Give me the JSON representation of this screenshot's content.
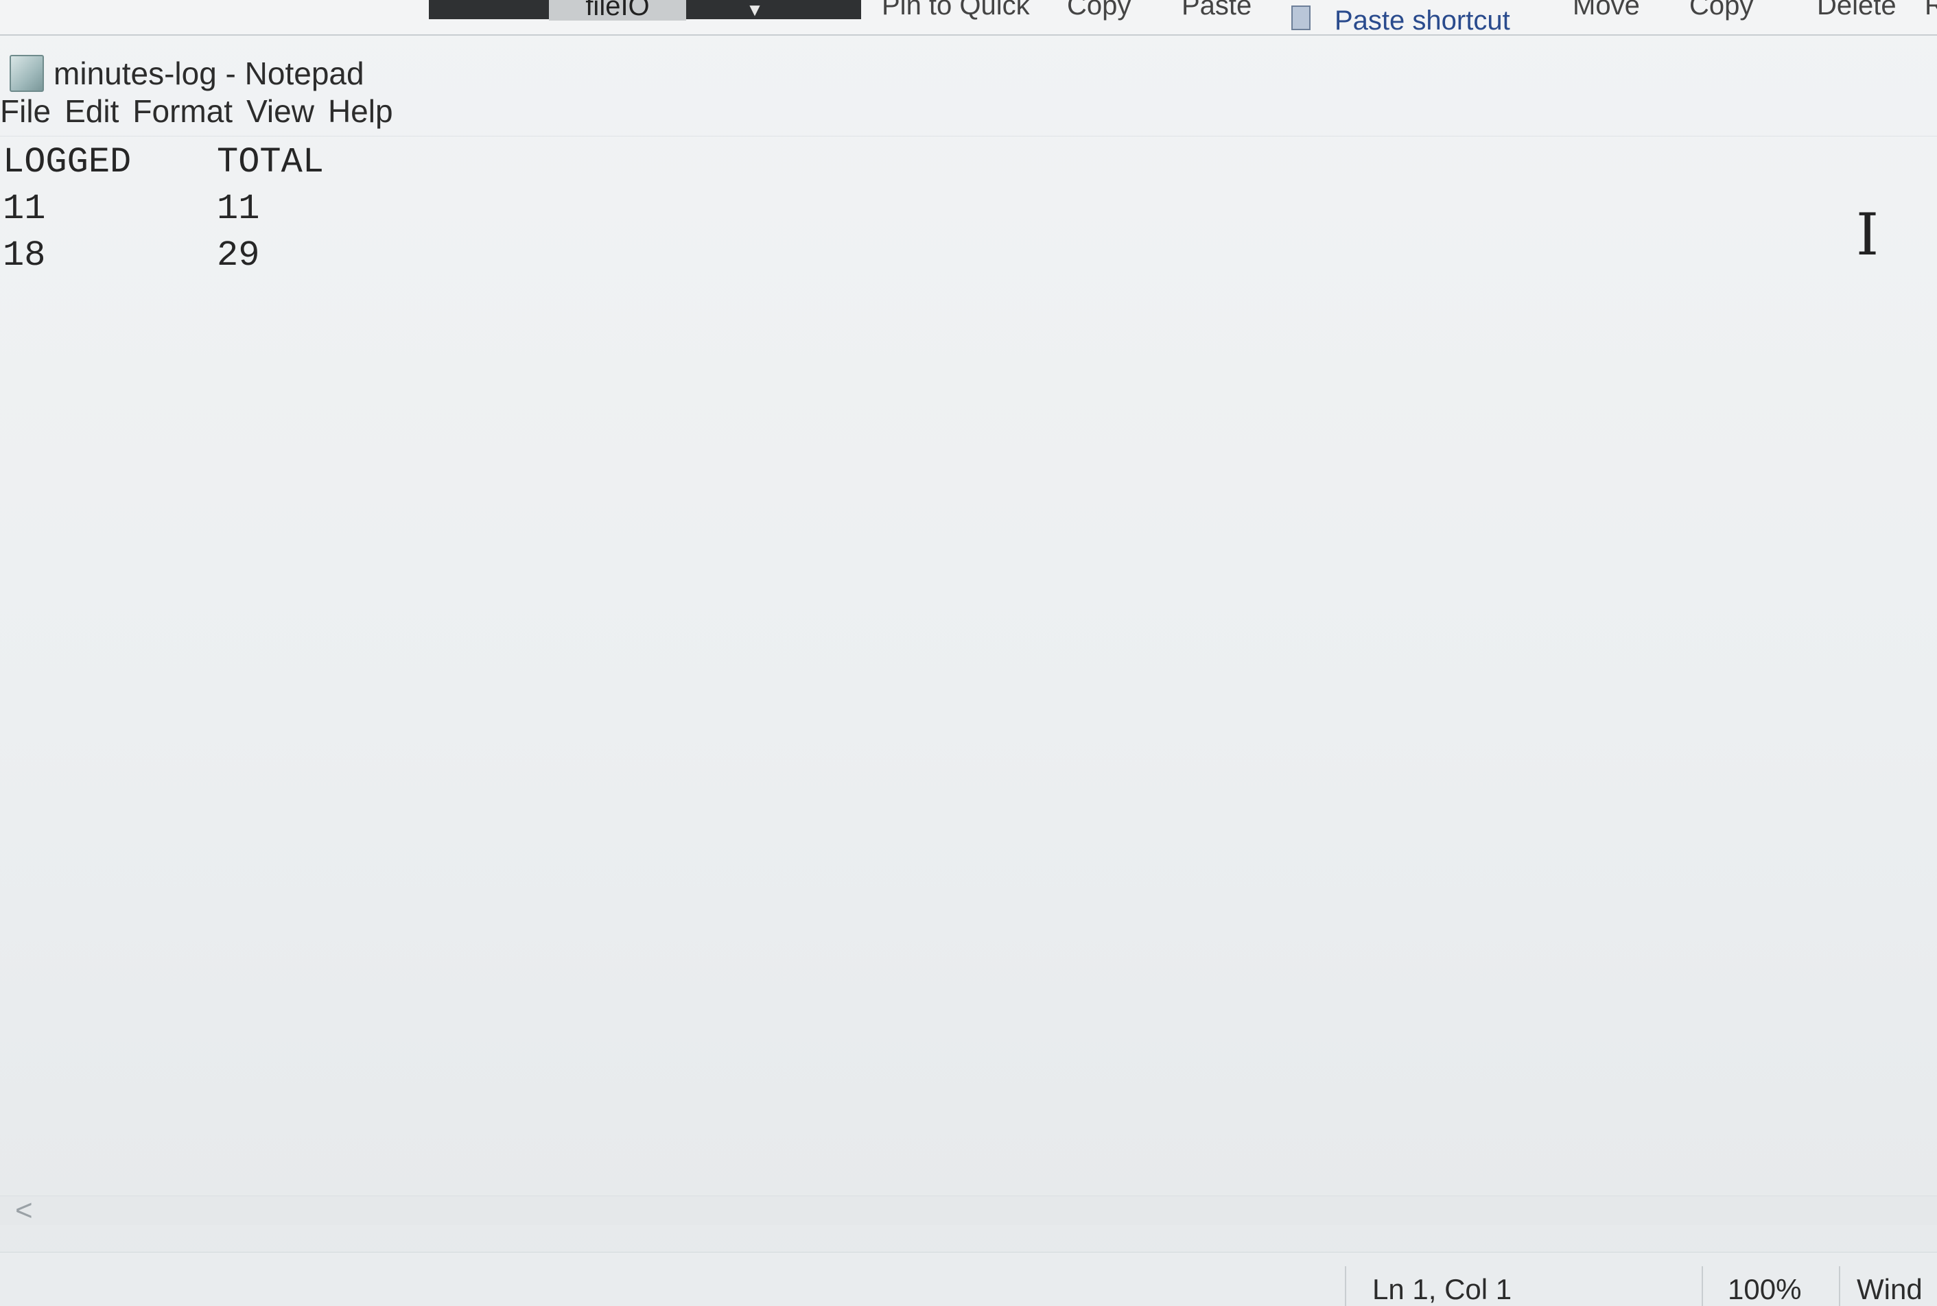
{
  "explorer": {
    "folder_tab": "fileIO",
    "dropdown_icon": "caret-down-icon",
    "ribbon": {
      "pin": "Pin to Quick",
      "copy_left": "Copy",
      "paste": "Paste",
      "paste_shortcut": "Paste shortcut",
      "move": "Move",
      "copy_right": "Copy",
      "delete": "Delete",
      "rename_partial": "R"
    }
  },
  "window": {
    "title": "minutes-log - Notepad",
    "icon": "notepad-icon"
  },
  "menu": {
    "items": [
      "File",
      "Edit",
      "Format",
      "View",
      "Help"
    ]
  },
  "document": {
    "header": [
      "LOGGED",
      "TOTAL"
    ],
    "rows": [
      [
        "11",
        "11"
      ],
      [
        "18",
        "29"
      ]
    ]
  },
  "editor": {
    "cursor_glyph": "I"
  },
  "scrollbar": {
    "left_arrow": "<"
  },
  "status": {
    "position": "Ln 1, Col 1",
    "zoom": "100%",
    "line_ending_partial": "Wind"
  }
}
